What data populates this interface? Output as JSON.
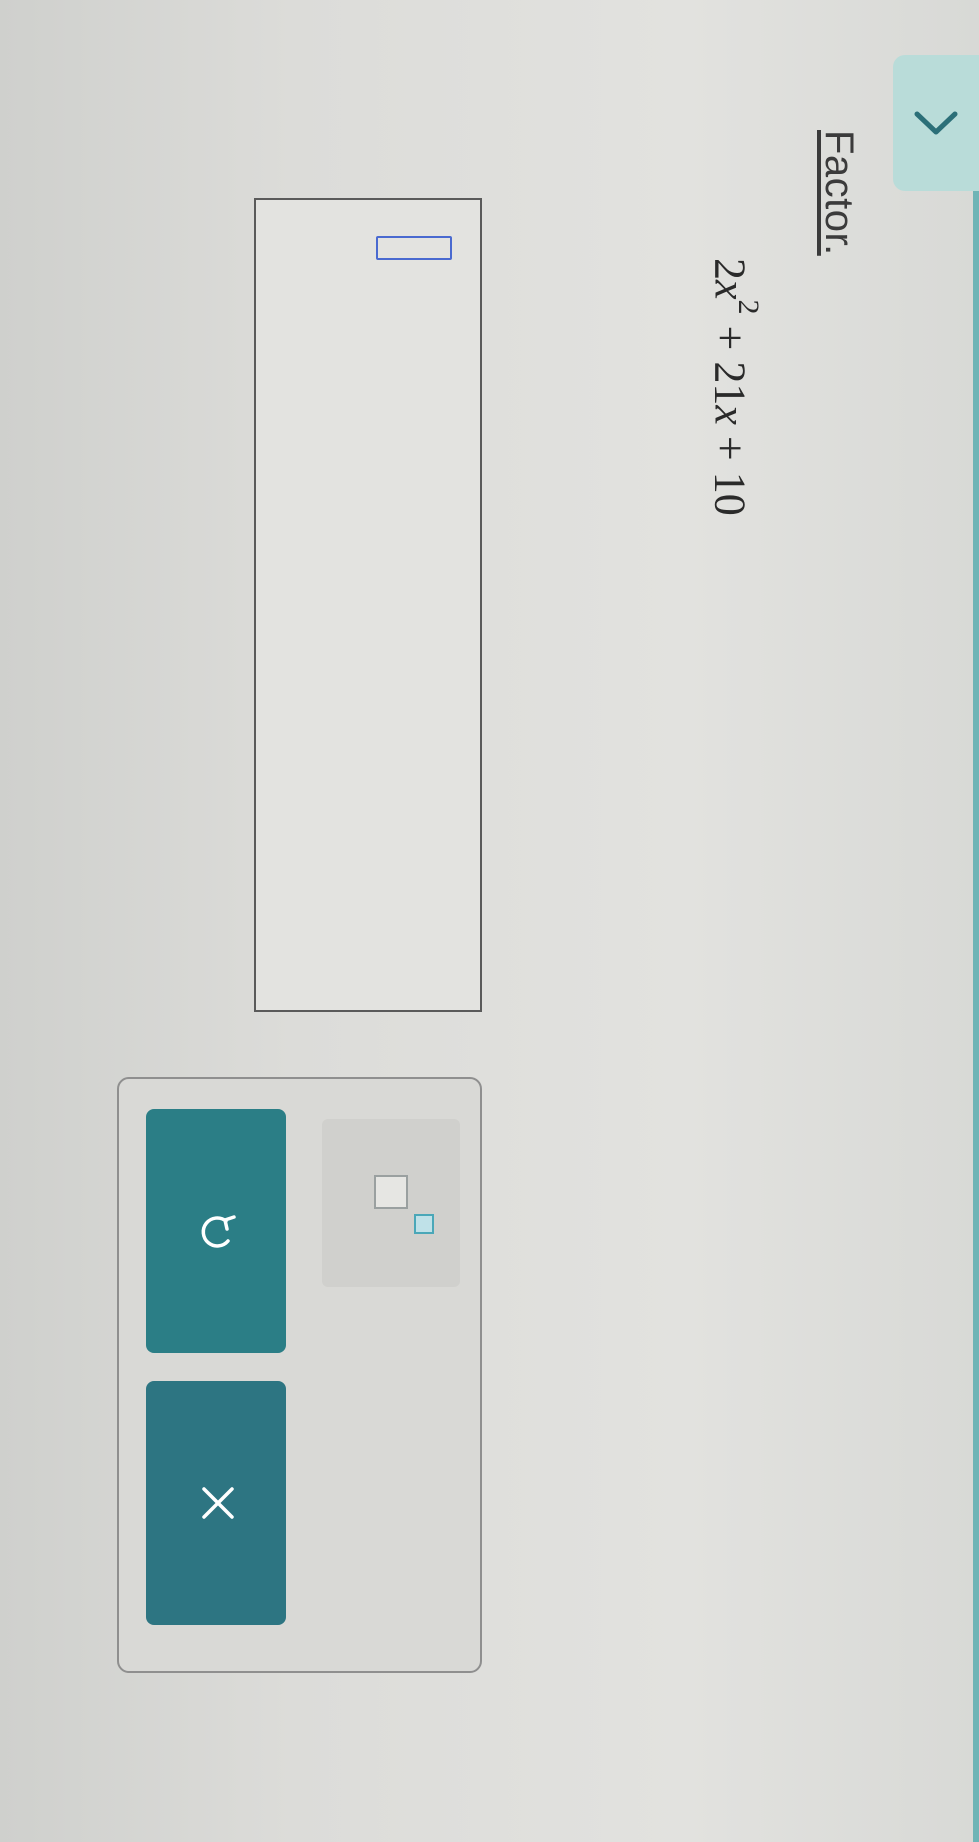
{
  "nav": {
    "collapse_icon": "chevron-left-icon"
  },
  "question": {
    "instruction": "Factor.",
    "expression": {
      "coef1": "2",
      "var1": "x",
      "exp1": "2",
      "op1": " + 21",
      "var2": "x",
      "op2": " + 10"
    }
  },
  "answer": {
    "value": ""
  },
  "toolbar": {
    "exponent_icon": "exponent-template-icon",
    "undo_icon": "undo-icon",
    "clear_icon": "clear-icon"
  },
  "colors": {
    "accent": "#2b7e86",
    "tab": "#b9dcd9",
    "answer_slot": "#4a6ad0"
  }
}
